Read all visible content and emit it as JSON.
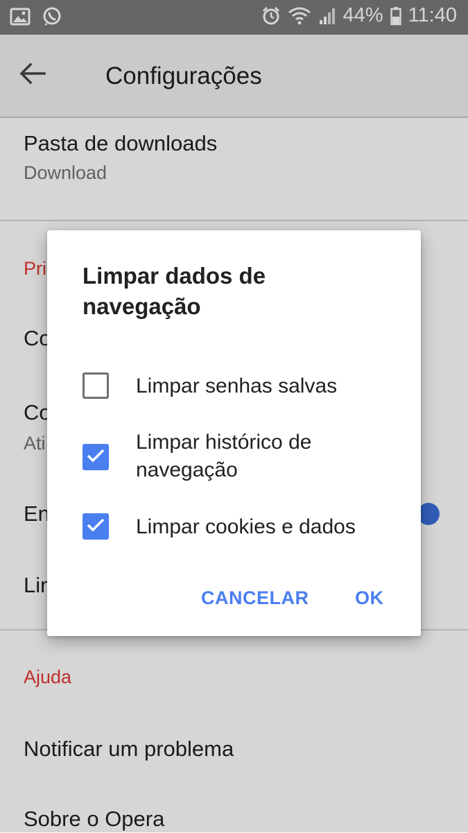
{
  "status_bar": {
    "battery": "44%",
    "time": "11:40",
    "icons": [
      "image-icon",
      "whatsapp-icon",
      "alarm-icon",
      "wifi-icon",
      "signal-icon",
      "battery-icon"
    ]
  },
  "toolbar": {
    "title": "Configurações",
    "back_icon": "arrow-left-icon"
  },
  "settings": {
    "download_folder": {
      "label": "Pasta de downloads",
      "value": "Download"
    },
    "privacy_header_partial": "Pri",
    "item1_partial": "Co",
    "item2_partial": "Co",
    "item2_sub_partial": "Ati",
    "item3_partial": "En",
    "item4_partial": "Lin",
    "help_header": "Ajuda",
    "report_problem": "Notificar um problema",
    "about": "Sobre o Opera"
  },
  "dialog": {
    "title": "Limpar dados de navegação",
    "options": [
      {
        "label": "Limpar senhas salvas",
        "checked": false
      },
      {
        "label": "Limpar histórico de navegação",
        "checked": true
      },
      {
        "label": "Limpar cookies e dados",
        "checked": true
      }
    ],
    "cancel_label": "CANCELAR",
    "ok_label": "OK"
  },
  "colors": {
    "accent": "#4a7ff0",
    "section_header": "#e53935",
    "toggle": "#3b6fdb",
    "status_bar": "#7a7a7a"
  }
}
